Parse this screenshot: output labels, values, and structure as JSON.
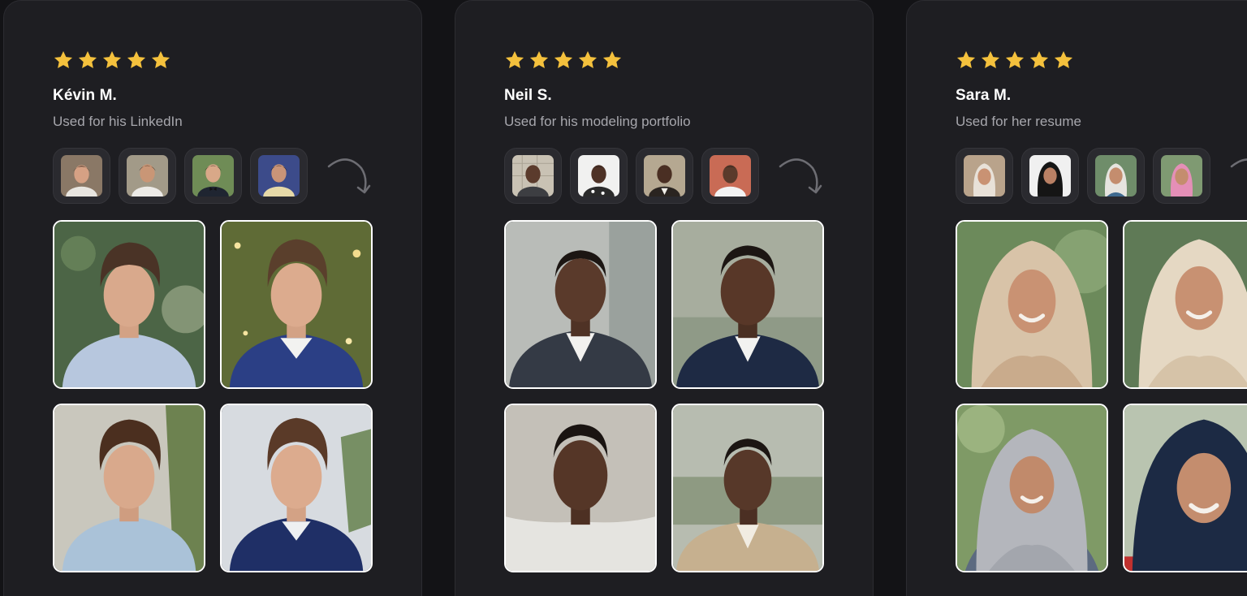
{
  "testimonials": [
    {
      "rating": 5,
      "name": "Kévin M.",
      "usage": "Used for his LinkedIn",
      "colors": {
        "skin": "#d9a98c",
        "hair": "#4a3326",
        "bg": "#5d7a52"
      }
    },
    {
      "rating": 5,
      "name": "Neil S.",
      "usage": "Used for his modeling portfolio",
      "colors": {
        "skin": "#5a3a2b",
        "hair": "#1c1613",
        "bg": "#b6b9b4"
      }
    },
    {
      "rating": 5,
      "name": "Sara M.",
      "usage": "Used for her resume",
      "colors": {
        "skin": "#c99273",
        "hijab": "#d8c3a8",
        "bg": "#6c8a5b"
      }
    }
  ],
  "colors": {
    "star": "#f4c13d",
    "card_bg": "#1e1e22",
    "page_bg": "#131316"
  },
  "icons": {
    "rating": "star-icon",
    "redo": "curved-arrow-icon"
  }
}
